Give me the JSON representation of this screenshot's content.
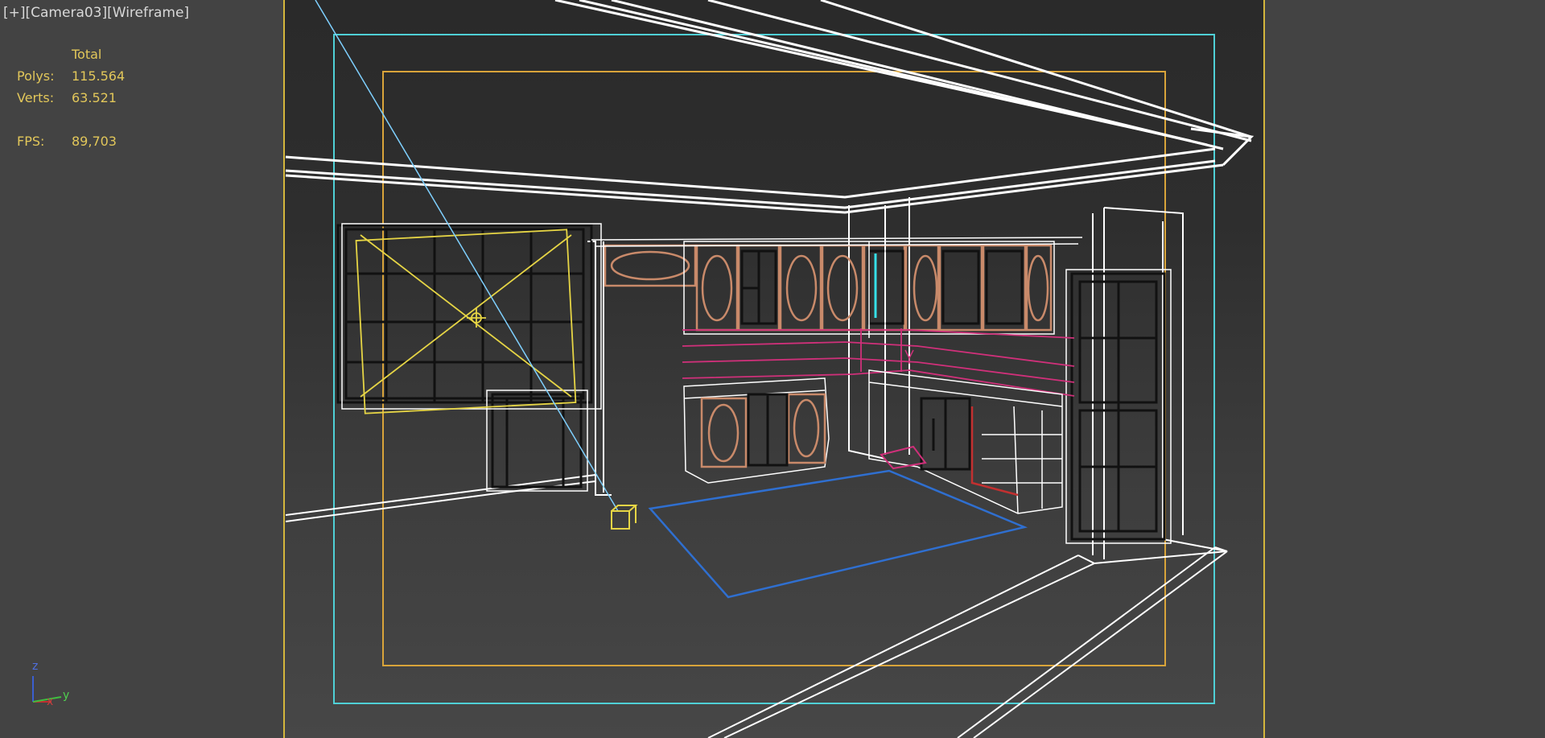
{
  "viewport": {
    "label_plus": "[+]",
    "label_camera": "[Camera03]",
    "label_mode": "[Wireframe]"
  },
  "stats": {
    "header": "Total",
    "polys_label": "Polys:",
    "polys_value": "115.564",
    "verts_label": "Verts:",
    "verts_value": "63.521",
    "fps_label": "FPS:",
    "fps_value": "89,703"
  },
  "axis_gizmo": {
    "z": "z",
    "x": "x",
    "y": "y"
  },
  "colors": {
    "safe_frame_outer": "#d4b63c",
    "safe_frame_action": "#4fd0d6",
    "safe_frame_title": "#d9a43a",
    "wire_white": "#ffffff",
    "wire_cabinet": "#c98a6a",
    "wire_magenta": "#d0307a",
    "light_yellow": "#e6d545",
    "rug_blue": "#2f6fd0",
    "camera_line": "#7fd0ff",
    "stats_text": "#e2c75a"
  }
}
